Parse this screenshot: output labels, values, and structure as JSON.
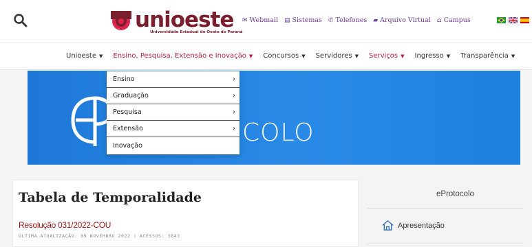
{
  "header": {
    "logo": {
      "name": "unioeste",
      "subtitle": "Universidade Estadual do Oeste do Paraná",
      "color": "#7b1e2e"
    },
    "quicklinks": [
      {
        "icon": "envelope-icon",
        "glyph": "✉",
        "label": "Webmail"
      },
      {
        "icon": "list-icon",
        "glyph": "▤",
        "label": "Sistemas"
      },
      {
        "icon": "phone-icon",
        "glyph": "✆",
        "label": "Telefones"
      },
      {
        "icon": "folder-icon",
        "glyph": "▰",
        "label": "Arquivo Virtual"
      },
      {
        "icon": "building-icon",
        "glyph": "⌂",
        "label": "Campus"
      }
    ],
    "flags": [
      "brazil-flag-icon",
      "uk-flag-icon",
      "spain-flag-icon"
    ]
  },
  "nav": {
    "items": [
      {
        "label": "Unioeste",
        "active": false
      },
      {
        "label": "Ensino, Pesquisa, Extensão e Inovação",
        "active": true
      },
      {
        "label": "Concursos",
        "active": false
      },
      {
        "label": "Servidores",
        "active": false
      },
      {
        "label": "Serviços",
        "active": true
      },
      {
        "label": "Ingresso",
        "active": false
      },
      {
        "label": "Transparência",
        "active": false
      }
    ],
    "caret": "▼"
  },
  "dropdown": {
    "items": [
      {
        "label": "Ensino",
        "has_submenu": true
      },
      {
        "label": "Graduação",
        "has_submenu": true
      },
      {
        "label": "Pesquisa",
        "has_submenu": true
      },
      {
        "label": "Extensão",
        "has_submenu": true
      },
      {
        "label": "Inovação",
        "has_submenu": false
      }
    ],
    "arrow": "›"
  },
  "banner": {
    "text": "COLO",
    "color": "#1e78d8"
  },
  "main": {
    "title": "Tabela de Temporalidade",
    "resolution": "Resolução 031/2022-COU",
    "meta": "ÚLTIMA ATUALIZAÇÃO: 09 NOVEMBRO 2022  |  ACESSOS: 3843"
  },
  "sidebar": {
    "title": "eProtocolo",
    "items": [
      {
        "icon": "home-icon",
        "label": "Apresentação"
      }
    ]
  },
  "colors": {
    "accent": "#b81e3c",
    "link": "#a01b1b",
    "quicklink": "#6a3a9a"
  }
}
